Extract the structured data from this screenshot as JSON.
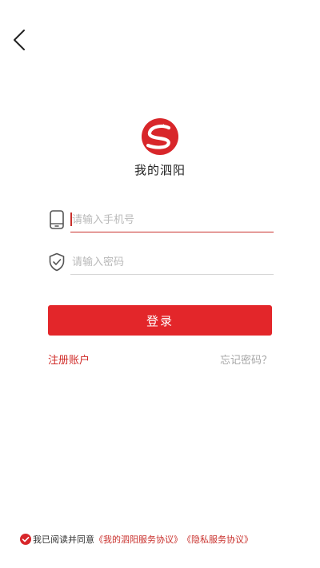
{
  "colors": {
    "brand_red": "#e3262a",
    "link_red": "#d02a27",
    "muted_gray": "#a6a6a6",
    "background": "#ffffff"
  },
  "header": {
    "back_icon": "chevron-left-icon"
  },
  "brand": {
    "logo_icon": "sihong-logo-icon",
    "app_name": "我的泗阳"
  },
  "login_form": {
    "phone": {
      "icon": "phone-icon",
      "value": "",
      "placeholder": "请输入手机号"
    },
    "password": {
      "icon": "shield-check-icon",
      "value": "",
      "placeholder": "请输入密码"
    },
    "submit_label": "登录"
  },
  "links": {
    "register_label": "注册账户",
    "forgot_label": "忘记密码？"
  },
  "agreement": {
    "checked": true,
    "prefix": "我已阅读并同意",
    "service_agreement_label": "《我的泗阳服务协议》",
    "privacy_agreement_label": "《隐私服务协议》"
  }
}
